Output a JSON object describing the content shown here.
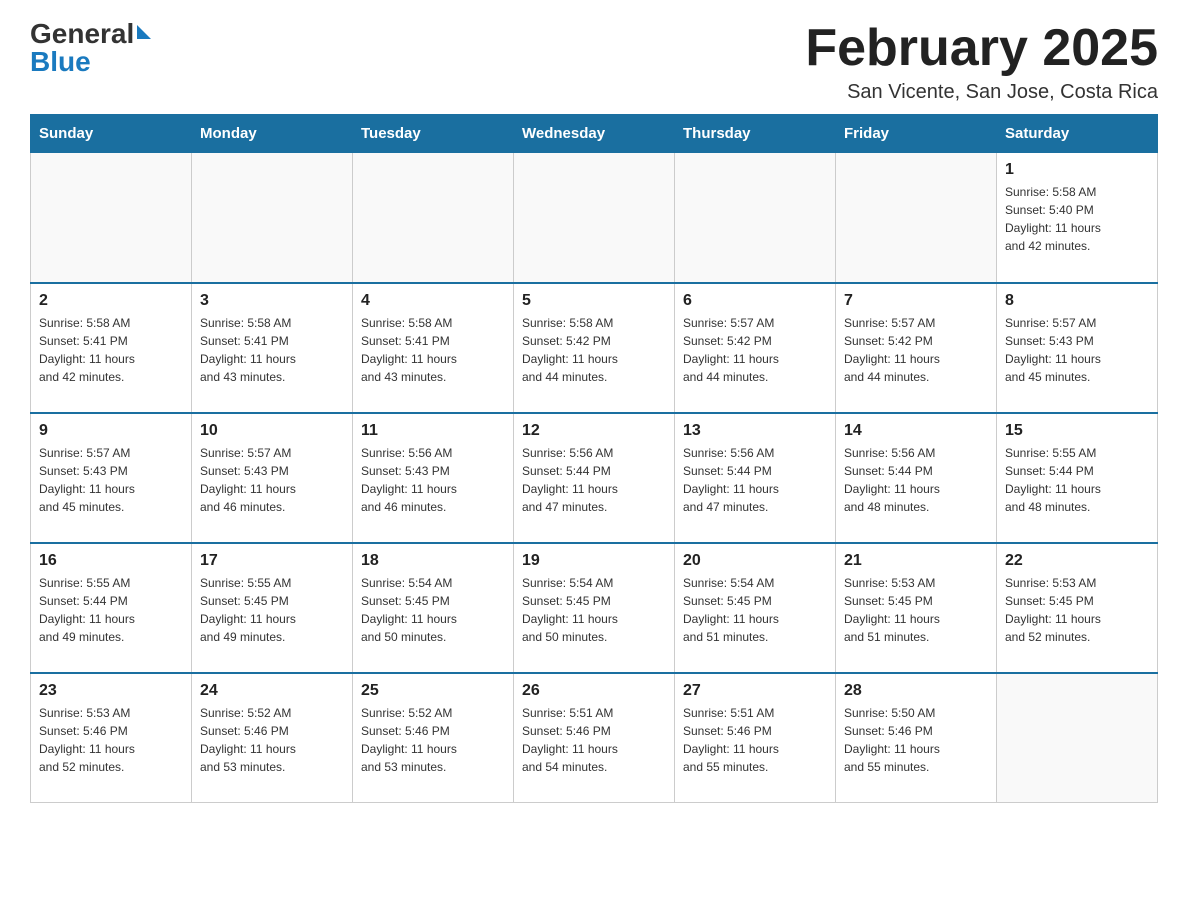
{
  "header": {
    "logo_general": "General",
    "logo_blue": "Blue",
    "month_title": "February 2025",
    "location": "San Vicente, San Jose, Costa Rica"
  },
  "weekdays": [
    "Sunday",
    "Monday",
    "Tuesday",
    "Wednesday",
    "Thursday",
    "Friday",
    "Saturday"
  ],
  "weeks": [
    [
      {
        "day": "",
        "info": ""
      },
      {
        "day": "",
        "info": ""
      },
      {
        "day": "",
        "info": ""
      },
      {
        "day": "",
        "info": ""
      },
      {
        "day": "",
        "info": ""
      },
      {
        "day": "",
        "info": ""
      },
      {
        "day": "1",
        "info": "Sunrise: 5:58 AM\nSunset: 5:40 PM\nDaylight: 11 hours\nand 42 minutes."
      }
    ],
    [
      {
        "day": "2",
        "info": "Sunrise: 5:58 AM\nSunset: 5:41 PM\nDaylight: 11 hours\nand 42 minutes."
      },
      {
        "day": "3",
        "info": "Sunrise: 5:58 AM\nSunset: 5:41 PM\nDaylight: 11 hours\nand 43 minutes."
      },
      {
        "day": "4",
        "info": "Sunrise: 5:58 AM\nSunset: 5:41 PM\nDaylight: 11 hours\nand 43 minutes."
      },
      {
        "day": "5",
        "info": "Sunrise: 5:58 AM\nSunset: 5:42 PM\nDaylight: 11 hours\nand 44 minutes."
      },
      {
        "day": "6",
        "info": "Sunrise: 5:57 AM\nSunset: 5:42 PM\nDaylight: 11 hours\nand 44 minutes."
      },
      {
        "day": "7",
        "info": "Sunrise: 5:57 AM\nSunset: 5:42 PM\nDaylight: 11 hours\nand 44 minutes."
      },
      {
        "day": "8",
        "info": "Sunrise: 5:57 AM\nSunset: 5:43 PM\nDaylight: 11 hours\nand 45 minutes."
      }
    ],
    [
      {
        "day": "9",
        "info": "Sunrise: 5:57 AM\nSunset: 5:43 PM\nDaylight: 11 hours\nand 45 minutes."
      },
      {
        "day": "10",
        "info": "Sunrise: 5:57 AM\nSunset: 5:43 PM\nDaylight: 11 hours\nand 46 minutes."
      },
      {
        "day": "11",
        "info": "Sunrise: 5:56 AM\nSunset: 5:43 PM\nDaylight: 11 hours\nand 46 minutes."
      },
      {
        "day": "12",
        "info": "Sunrise: 5:56 AM\nSunset: 5:44 PM\nDaylight: 11 hours\nand 47 minutes."
      },
      {
        "day": "13",
        "info": "Sunrise: 5:56 AM\nSunset: 5:44 PM\nDaylight: 11 hours\nand 47 minutes."
      },
      {
        "day": "14",
        "info": "Sunrise: 5:56 AM\nSunset: 5:44 PM\nDaylight: 11 hours\nand 48 minutes."
      },
      {
        "day": "15",
        "info": "Sunrise: 5:55 AM\nSunset: 5:44 PM\nDaylight: 11 hours\nand 48 minutes."
      }
    ],
    [
      {
        "day": "16",
        "info": "Sunrise: 5:55 AM\nSunset: 5:44 PM\nDaylight: 11 hours\nand 49 minutes."
      },
      {
        "day": "17",
        "info": "Sunrise: 5:55 AM\nSunset: 5:45 PM\nDaylight: 11 hours\nand 49 minutes."
      },
      {
        "day": "18",
        "info": "Sunrise: 5:54 AM\nSunset: 5:45 PM\nDaylight: 11 hours\nand 50 minutes."
      },
      {
        "day": "19",
        "info": "Sunrise: 5:54 AM\nSunset: 5:45 PM\nDaylight: 11 hours\nand 50 minutes."
      },
      {
        "day": "20",
        "info": "Sunrise: 5:54 AM\nSunset: 5:45 PM\nDaylight: 11 hours\nand 51 minutes."
      },
      {
        "day": "21",
        "info": "Sunrise: 5:53 AM\nSunset: 5:45 PM\nDaylight: 11 hours\nand 51 minutes."
      },
      {
        "day": "22",
        "info": "Sunrise: 5:53 AM\nSunset: 5:45 PM\nDaylight: 11 hours\nand 52 minutes."
      }
    ],
    [
      {
        "day": "23",
        "info": "Sunrise: 5:53 AM\nSunset: 5:46 PM\nDaylight: 11 hours\nand 52 minutes."
      },
      {
        "day": "24",
        "info": "Sunrise: 5:52 AM\nSunset: 5:46 PM\nDaylight: 11 hours\nand 53 minutes."
      },
      {
        "day": "25",
        "info": "Sunrise: 5:52 AM\nSunset: 5:46 PM\nDaylight: 11 hours\nand 53 minutes."
      },
      {
        "day": "26",
        "info": "Sunrise: 5:51 AM\nSunset: 5:46 PM\nDaylight: 11 hours\nand 54 minutes."
      },
      {
        "day": "27",
        "info": "Sunrise: 5:51 AM\nSunset: 5:46 PM\nDaylight: 11 hours\nand 55 minutes."
      },
      {
        "day": "28",
        "info": "Sunrise: 5:50 AM\nSunset: 5:46 PM\nDaylight: 11 hours\nand 55 minutes."
      },
      {
        "day": "",
        "info": ""
      }
    ]
  ]
}
